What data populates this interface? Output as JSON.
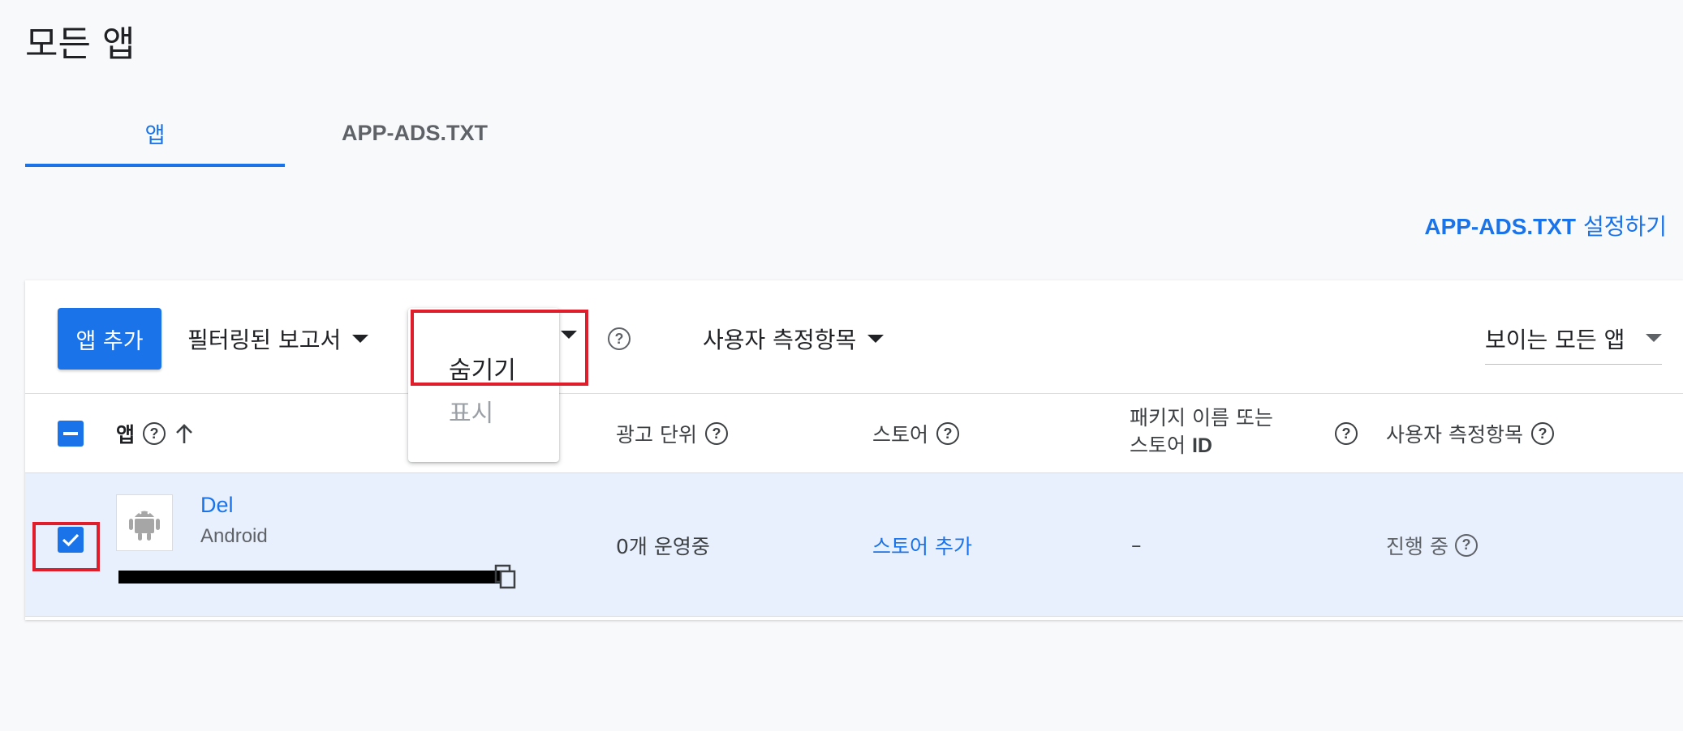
{
  "page": {
    "title": "모든 앱"
  },
  "tabs": [
    {
      "label": "앱"
    },
    {
      "label": "APP-ADS.TXT"
    }
  ],
  "setup_link": {
    "latin": "APP-ADS.TXT",
    "korean": " 설정하기"
  },
  "toolbar": {
    "add_app": "앱 추가",
    "filtered_report": "필터링된 보고서",
    "visibility_menu": {
      "options": [
        "숨기기",
        "표시"
      ]
    },
    "user_metrics": "사용자 측정항목",
    "view_select": "보이는 모든 앱"
  },
  "table": {
    "headers": {
      "app": "앱",
      "ad_units": "광고 단위",
      "store": "스토어",
      "package_line1": "패키지 이름 또는",
      "package_line2_ko": "스토어 ",
      "package_line2_id": "ID",
      "user_metrics": "사용자 측정항목"
    },
    "rows": [
      {
        "name": "Del",
        "platform": "Android",
        "ad_units": "0개 운영중",
        "store": "스토어 추가",
        "package": "–",
        "user_metrics": "진행 중"
      }
    ]
  },
  "colors": {
    "accent": "#1a73e8",
    "highlight": "#e01e2b",
    "selected_row": "#e8f0fe"
  },
  "icons": [
    "help-icon",
    "sort-arrow-up-icon",
    "android-icon",
    "copy-icon",
    "check-icon",
    "minus-icon",
    "dropdown-caret-icon"
  ]
}
